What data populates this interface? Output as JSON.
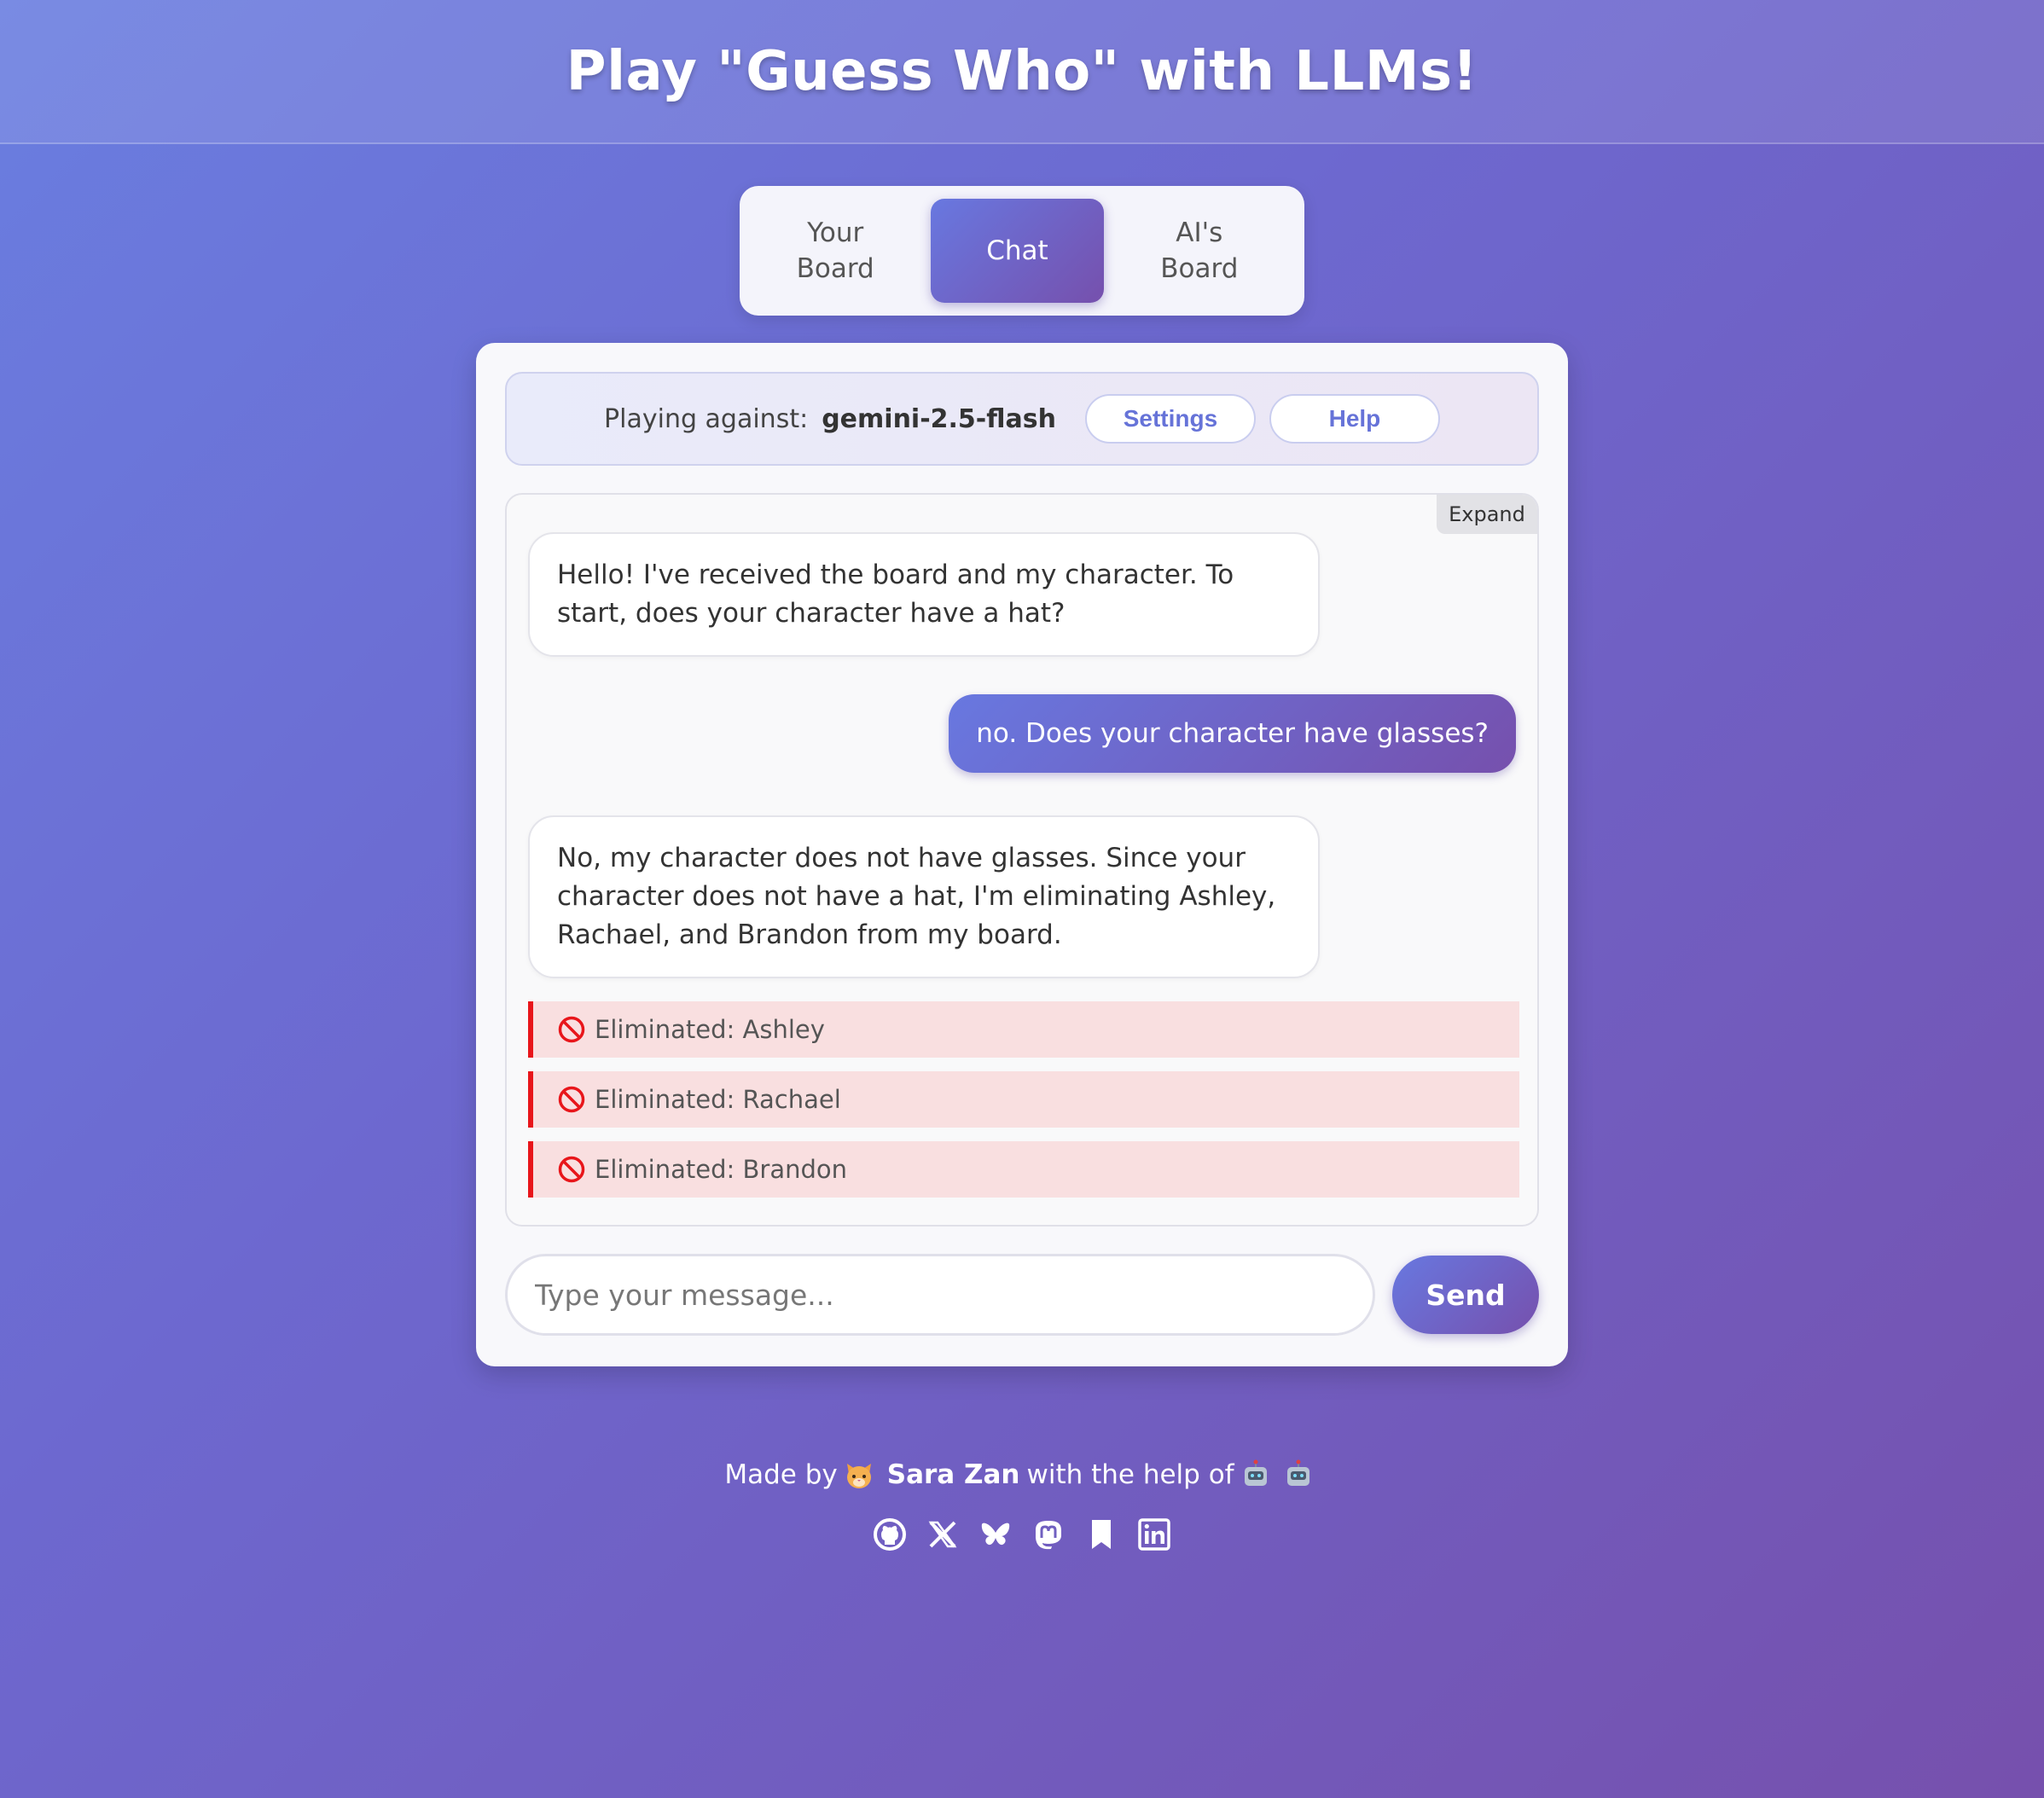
{
  "header": {
    "title": "Play \"Guess Who\" with LLMs!"
  },
  "tabs": [
    {
      "label": "Your\nBoard",
      "active": false
    },
    {
      "label": "Chat",
      "active": true
    },
    {
      "label": "AI's\nBoard",
      "active": false
    }
  ],
  "status": {
    "label": "Playing against:",
    "model": "gemini-2.5-flash",
    "settings_label": "Settings",
    "help_label": "Help"
  },
  "chat": {
    "expand_label": "Expand",
    "messages": [
      {
        "role": "ai",
        "text": "Hello! I've received the board and my character. To start, does your character have a hat?"
      },
      {
        "role": "user",
        "text": "no. Does your character have glasses?"
      },
      {
        "role": "ai",
        "text": "No, my character does not have glasses. Since your character does not have a hat, I'm eliminating Ashley, Rachael, and Brandon from my board."
      }
    ],
    "eliminations": [
      "Eliminated: Ashley",
      "Eliminated: Rachael",
      "Eliminated: Brandon"
    ]
  },
  "composer": {
    "placeholder": "Type your message...",
    "send_label": "Send"
  },
  "footer": {
    "made_by": "Made by",
    "author": "Sara Zan",
    "with_help": "with the help of",
    "social_icons": [
      "github-icon",
      "x-icon",
      "bluesky-icon",
      "mastodon-icon",
      "bookmark-icon",
      "linkedin-icon"
    ]
  },
  "colors": {
    "accent_start": "#6878e0",
    "accent_end": "#7650ad",
    "elimination_bg": "#f9dfe0",
    "elimination_border": "#e8161b",
    "link": "#6673d8"
  }
}
